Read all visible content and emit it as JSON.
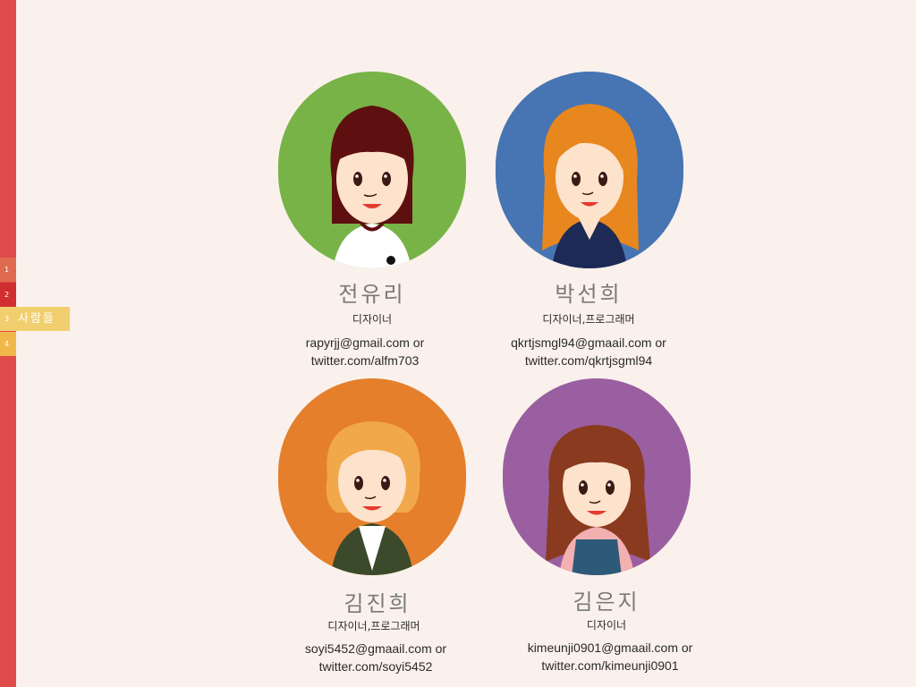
{
  "nav": {
    "steps": [
      {
        "num": "1"
      },
      {
        "num": "2"
      },
      {
        "num": "3",
        "label": "사람들"
      },
      {
        "num": "4"
      }
    ]
  },
  "people": [
    {
      "name": "전유리",
      "role": "디자이너",
      "email": "rapyrjj@gmail.com or",
      "twitter": "twitter.com/alfm703",
      "bg_color": "#78b348"
    },
    {
      "name": "박선희",
      "role": "디자이너,프로그래머",
      "email": "qkrtjsmgl94@gmaail.com or",
      "twitter": "twitter.com/qkrtjsgml94",
      "bg_color": "#4774b2"
    },
    {
      "name": "김진희",
      "role": "디자이너,프로그래머",
      "email": "soyi5452@gmaail.com or",
      "twitter": "twitter.com/soyi5452",
      "bg_color": "#e57f2b"
    },
    {
      "name": "김은지",
      "role": "디자이너",
      "email": "kimeunji0901@gmaail.com or",
      "twitter": "twitter.com/kimeunji0901",
      "bg_color": "#9a5fa1"
    }
  ]
}
